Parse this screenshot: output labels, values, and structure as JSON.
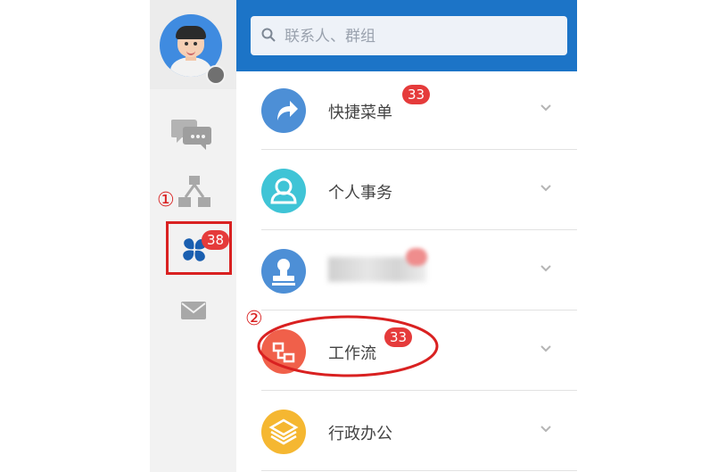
{
  "nav": {
    "apps_badge": "38",
    "step_markers": [
      "①",
      "②"
    ]
  },
  "search": {
    "placeholder": "联系人、群组"
  },
  "menu": {
    "items": [
      {
        "label": "快捷菜单",
        "badge": "33",
        "color": "#4d8fd6",
        "icon": "share-arrow-icon"
      },
      {
        "label": "个人事务",
        "badge": "",
        "color": "#3fc4d6",
        "icon": "person-icon"
      },
      {
        "label": "",
        "badge": "",
        "color": "#4d8fd6",
        "icon": "stamp-icon"
      },
      {
        "label": "工作流",
        "badge": "33",
        "color": "#f0604a",
        "icon": "workflow-icon"
      },
      {
        "label": "行政办公",
        "badge": "",
        "color": "#f5b731",
        "icon": "layers-icon"
      }
    ]
  },
  "colors": {
    "header_blue": "#1c74c7",
    "highlight_red": "#d92121",
    "badge_red": "#e53b3b"
  }
}
